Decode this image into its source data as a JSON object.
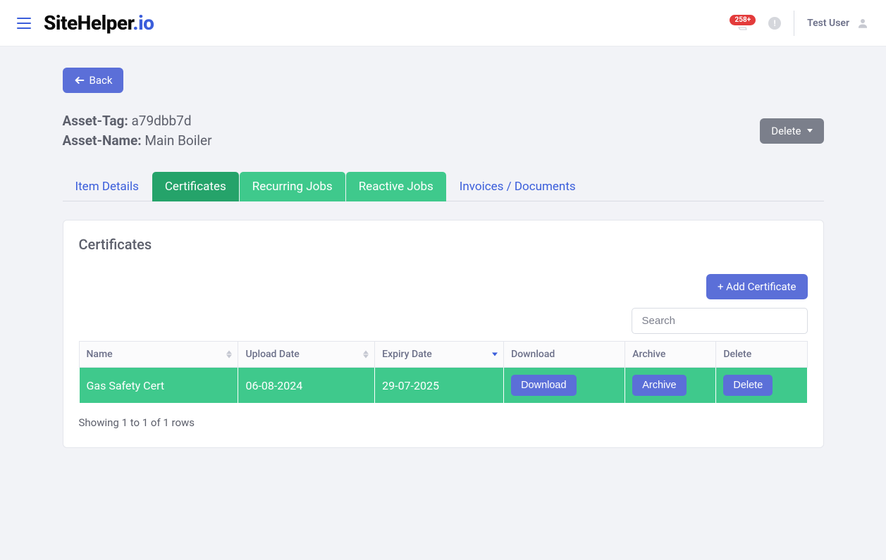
{
  "navbar": {
    "brand_main": "SiteHelper",
    "brand_suffix": ".io",
    "badge_count": "258+",
    "user_name": "Test User"
  },
  "back_button_label": "Back",
  "asset": {
    "tag_label": "Asset-Tag:",
    "tag_value": "a79dbb7d",
    "name_label": "Asset-Name:",
    "name_value": "Main Boiler",
    "delete_label": "Delete"
  },
  "tabs": [
    {
      "label": "Item Details",
      "state": "link"
    },
    {
      "label": "Certificates",
      "state": "active-dark"
    },
    {
      "label": "Recurring Jobs",
      "state": "active-light"
    },
    {
      "label": "Reactive Jobs",
      "state": "active-light"
    },
    {
      "label": "Invoices / Documents",
      "state": "link"
    }
  ],
  "card": {
    "title": "Certificates",
    "add_button": "+ Add Certificate",
    "search_placeholder": "Search"
  },
  "table": {
    "columns": {
      "name": "Name",
      "upload_date": "Upload Date",
      "expiry_date": "Expiry Date",
      "download": "Download",
      "archive": "Archive",
      "delete": "Delete"
    },
    "rows": [
      {
        "name": "Gas Safety Cert",
        "upload_date": "06-08-2024",
        "expiry_date": "29-07-2025",
        "download_label": "Download",
        "archive_label": "Archive",
        "delete_label": "Delete"
      }
    ],
    "footer": "Showing 1 to 1 of 1 rows"
  }
}
